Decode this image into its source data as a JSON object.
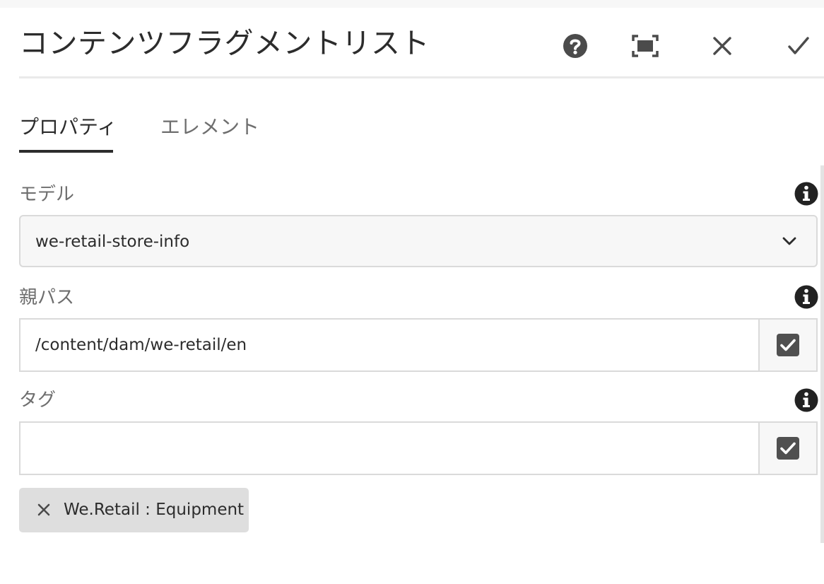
{
  "dialog": {
    "title": "コンテンツフラグメントリスト",
    "header_buttons": {
      "help_icon": "question-circle-icon",
      "fullscreen_icon": "fullscreen-icon",
      "cancel_icon": "close-icon",
      "done_icon": "checkmark-icon"
    }
  },
  "tabs": [
    {
      "label": "プロパティ",
      "active": true
    },
    {
      "label": "エレメント",
      "active": false
    }
  ],
  "fields": {
    "model": {
      "label": "モデル",
      "value": "we-retail-store-info",
      "info_icon": "info-circle-icon",
      "dropdown_icon": "chevron-down-icon"
    },
    "parent_path": {
      "label": "親パス",
      "value": "/content/dam/we-retail/en",
      "info_icon": "info-circle-icon",
      "picker_icon": "checkbox-icon"
    },
    "tags": {
      "label": "タグ",
      "value": "",
      "info_icon": "info-circle-icon",
      "picker_icon": "checkbox-icon",
      "selected": [
        {
          "label": "We.Retail : Equipment",
          "remove_icon": "close-icon"
        }
      ]
    }
  },
  "colors": {
    "text": "#2c2c2c",
    "label": "#6e6e6e",
    "border": "#dadada",
    "tag_bg": "#dedede",
    "icon": "#4b4b4b"
  }
}
